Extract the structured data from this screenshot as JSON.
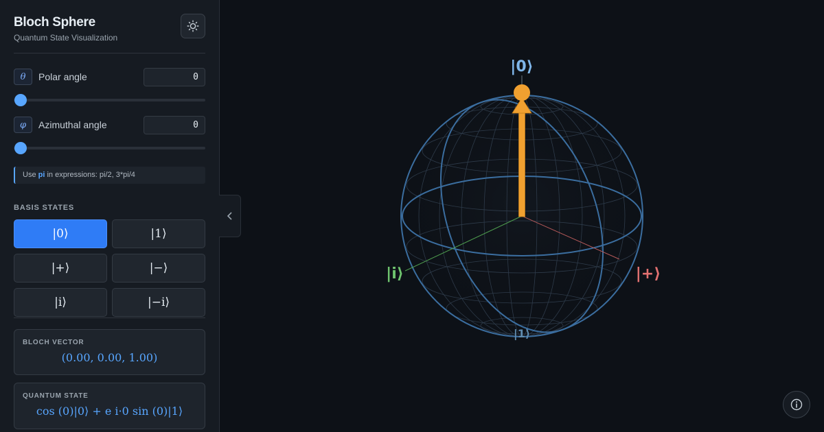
{
  "app": {
    "title": "Bloch Sphere",
    "subtitle": "Quantum State Visualization",
    "theme_toggle_icon": "sun-icon"
  },
  "params": {
    "polar": {
      "symbol": "θ",
      "label": "Polar angle",
      "value": "0",
      "slider_fraction": 0
    },
    "azimuthal": {
      "symbol": "φ",
      "label": "Azimuthal angle",
      "value": "0",
      "slider_fraction": 0
    }
  },
  "hint": {
    "prefix": "Use ",
    "keyword": "pi",
    "suffix": " in expressions: pi/2, 3*pi/4"
  },
  "basis": {
    "heading": "BASIS STATES",
    "states": [
      "|0⟩",
      "|1⟩",
      "|+⟩",
      "|−⟩",
      "|i⟩",
      "|−i⟩"
    ],
    "active": "|0⟩"
  },
  "bloch_vector": {
    "heading": "BLOCH VECTOR",
    "value": "(0.00,  0.00,  1.00)"
  },
  "quantum_state": {
    "heading": "QUANTUM STATE",
    "value": "cos (0)|0⟩ + e i·0 sin (0)|1⟩"
  },
  "scene": {
    "axis_labels": {
      "top": "|0⟩",
      "bottom": "|1⟩",
      "x": "|+⟩",
      "y": "|i⟩"
    },
    "colors": {
      "background": "#0d1117",
      "state_vector": "#f0a030",
      "x_axis": "#e07070",
      "y_axis": "#6fc46f",
      "z_label": "#7fb6ea",
      "wireframe": "#3a4a5c",
      "great_circles": "#3b6ea0",
      "accent": "#58a6ff"
    },
    "collapse_icon": "chevron-left-icon",
    "info_icon": "info-icon"
  }
}
